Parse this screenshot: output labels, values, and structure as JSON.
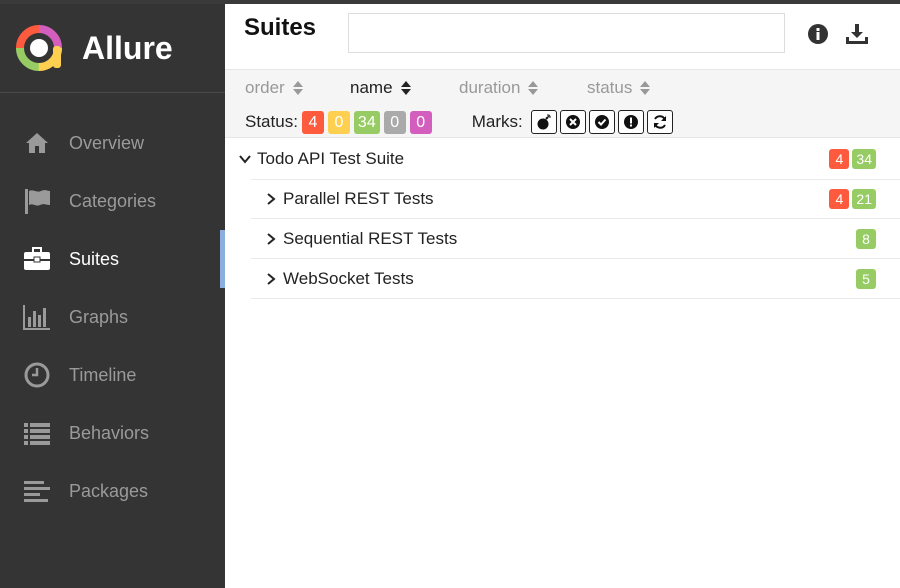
{
  "app": {
    "name": "Allure"
  },
  "sidebar": {
    "items": [
      {
        "label": "Overview",
        "icon": "home-icon",
        "active": false
      },
      {
        "label": "Categories",
        "icon": "flag-icon",
        "active": false
      },
      {
        "label": "Suites",
        "icon": "briefcase-icon",
        "active": true
      },
      {
        "label": "Graphs",
        "icon": "bar-chart-icon",
        "active": false
      },
      {
        "label": "Timeline",
        "icon": "clock-icon",
        "active": false
      },
      {
        "label": "Behaviors",
        "icon": "list-icon",
        "active": false
      },
      {
        "label": "Packages",
        "icon": "align-left-icon",
        "active": false
      }
    ]
  },
  "header": {
    "title": "Suites",
    "search_value": ""
  },
  "sort": {
    "order": "order",
    "name": "name",
    "duration": "duration",
    "status": "status"
  },
  "status_filter": {
    "label": "Status:",
    "failed": "4",
    "broken": "0",
    "passed": "34",
    "skipped": "0",
    "unknown": "0"
  },
  "marks": {
    "label": "Marks:"
  },
  "colors": {
    "sidebar_bg": "#343434",
    "active_indicator": "#8aaee0",
    "failed": "#fd5a3e",
    "broken": "#ffd050",
    "passed": "#97cc64",
    "skipped": "#aaaaaa",
    "unknown": "#d35ebe"
  },
  "tree": {
    "root": {
      "name": "Todo API Test Suite",
      "failed": "4",
      "passed": "34"
    },
    "children": [
      {
        "name": "Parallel REST Tests",
        "failed": "4",
        "passed": "21"
      },
      {
        "name": "Sequential REST Tests",
        "failed": "",
        "passed": "8"
      },
      {
        "name": "WebSocket Tests",
        "failed": "",
        "passed": "5"
      }
    ]
  }
}
